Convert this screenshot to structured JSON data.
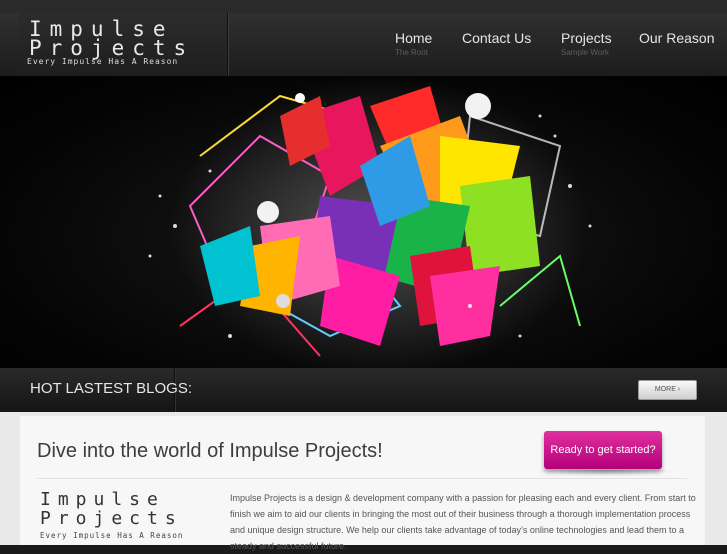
{
  "brand": {
    "line1": "Impulse",
    "line2": "Projects",
    "tagline": "Every Impulse Has A Reason"
  },
  "nav": {
    "items": [
      {
        "label": "Home",
        "sub": "The Root"
      },
      {
        "label": "Contact Us",
        "sub": ""
      },
      {
        "label": "Projects",
        "sub": "Sample Work"
      },
      {
        "label": "Our Reason",
        "sub": ""
      }
    ]
  },
  "blogs": {
    "title": "HOT LASTEST BLOGS:",
    "more_label": "MORE ›"
  },
  "intro": {
    "headline": "Dive into the world of Impulse Projects!",
    "cta_label": "Ready to get started?",
    "about": "Impulse Projects is a design & development company with a passion for pleasing each and every client. From start to finish we aim to aid our clients in bringing the most out of their business through a thorough implementation process and unique design structure. We help our clients take advantage of today’s online technologies and lead them to a steady and successful future."
  },
  "colors": {
    "cta": "#c8108a",
    "header_bg": "#262626",
    "content_bg": "#f7f7f7"
  }
}
